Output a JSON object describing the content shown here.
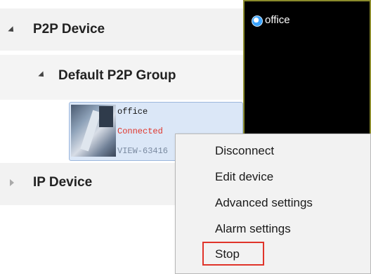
{
  "tree": {
    "p2p_label": "P2P Device",
    "group_label": "Default P2P Group",
    "ip_label": "IP Device"
  },
  "device": {
    "name": "office",
    "status": "Connected",
    "status_color": "#e0342a",
    "id": "VIEW-63416"
  },
  "video": {
    "title": "office"
  },
  "context_menu": {
    "items": [
      "Disconnect",
      "Edit device",
      "Advanced settings",
      "Alarm settings",
      "Stop"
    ],
    "highlight_color": "#e0342a"
  }
}
